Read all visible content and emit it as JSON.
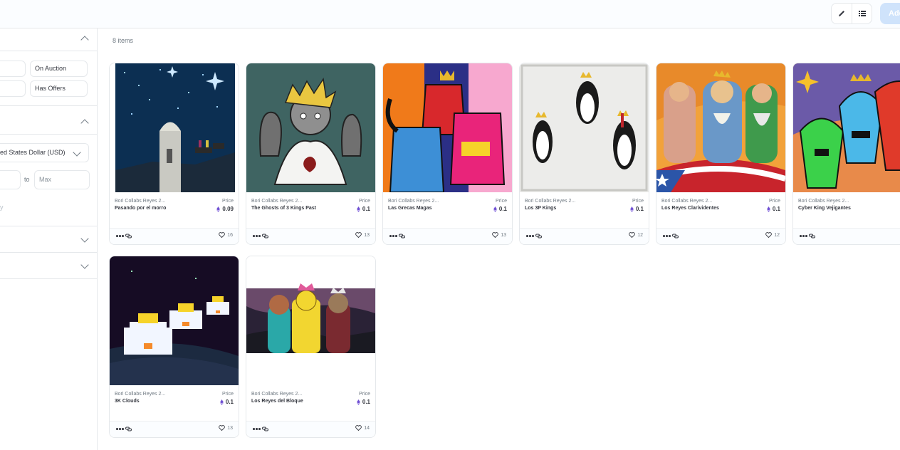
{
  "toolbar": {
    "edit_icon": "pencil-icon",
    "list_icon": "list-view-icon",
    "add_label": "Add"
  },
  "filters": {
    "status": {
      "on_auction": "On Auction",
      "has_offers": "Has Offers"
    },
    "price": {
      "currency": "ed States Dollar (USD)",
      "min_placeholder": "",
      "to": "to",
      "max_placeholder": "Max",
      "apply": "y"
    }
  },
  "results": {
    "count": "8 items"
  },
  "cards": [
    {
      "collection": "Bori Collabs Reyes 2...",
      "name": "Pasando por el morro",
      "price_label": "Price",
      "price": "0.09",
      "likes": "16"
    },
    {
      "collection": "Bori Collabs Reyes 2...",
      "name": "The Ghosts of 3 Kings Past",
      "price_label": "Price",
      "price": "0.1",
      "likes": "13"
    },
    {
      "collection": "Bori Collabs Reyes 2...",
      "name": "Las Grecas Magas",
      "price_label": "Price",
      "price": "0.1",
      "likes": "13"
    },
    {
      "collection": "Bori Collabs Reyes 2...",
      "name": "Los 3P Kings",
      "price_label": "Price",
      "price": "0.1",
      "likes": "12"
    },
    {
      "collection": "Bori Collabs Reyes 2...",
      "name": "Los Reyes Clarividentes",
      "price_label": "Price",
      "price": "0.1",
      "likes": "12"
    },
    {
      "collection": "Bori Collabs Reyes 2...",
      "name": "Cyber King Vejigantes",
      "price_label": "",
      "price": "",
      "likes": ""
    },
    {
      "collection": "Bori Collabs Reyes 2...",
      "name": "3K Clouds",
      "price_label": "Price",
      "price": "0.1",
      "likes": "13"
    },
    {
      "collection": "Bori Collabs Reyes 2...",
      "name": "Los Reyes del Bloque",
      "price_label": "Price",
      "price": "0.1",
      "likes": "14"
    }
  ],
  "colors": {
    "accent": "#2081e2",
    "eth": "#6f4fd3",
    "border": "#e5e8eb"
  }
}
